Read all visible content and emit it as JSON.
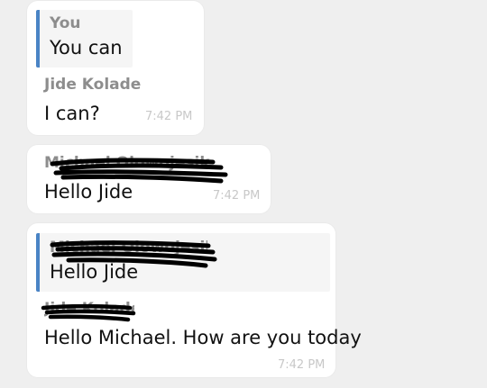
{
  "messages": [
    {
      "reply": {
        "name": "You",
        "text": "You can"
      },
      "sender": "Jide Kolade",
      "text": "I can?",
      "time": "7:42 PM"
    },
    {
      "sender": "Michael Olowojesiku",
      "text": "Hello Jide",
      "time": "7:42 PM"
    },
    {
      "reply": {
        "name": "Michael Olowojesiku",
        "text": "Hello Jide"
      },
      "sender": "Jide Kolade",
      "text": "Hello Michael. How are you today",
      "time": "7:42 PM"
    }
  ],
  "colors": {
    "background": "#efefef",
    "bubble": "#ffffff",
    "quote_background": "#f5f5f5",
    "quote_bar": "#4a84c5",
    "name_text": "#8d8d8d",
    "time_text": "#c8c8c8",
    "redaction_ink": "#000000"
  }
}
